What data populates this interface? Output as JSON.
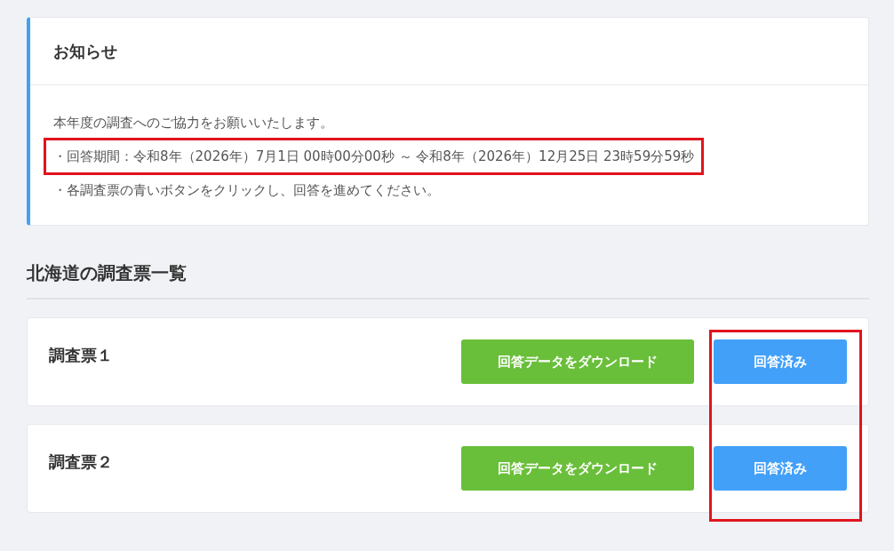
{
  "notice": {
    "title": "お知らせ",
    "lines": [
      {
        "text": "本年度の調査へのご協力をお願いいたします。",
        "highlighted": false
      },
      {
        "text": "・回答期間：令和8年（2026年）7月1日 00時00分00秒 ～ 令和8年（2026年）12月25日 23時59分59秒",
        "highlighted": true
      },
      {
        "text": "・各調査票の青いボタンをクリックし、回答を進めてください。",
        "highlighted": false
      }
    ]
  },
  "survey_list": {
    "title": "北海道の調査票一覧",
    "status_highlighted": true,
    "items": [
      {
        "name": "調査票１",
        "download_button": "回答データをダウンロード",
        "status_button": "回答済み"
      },
      {
        "name": "調査票２",
        "download_button": "回答データをダウンロード",
        "status_button": "回答済み"
      }
    ]
  }
}
